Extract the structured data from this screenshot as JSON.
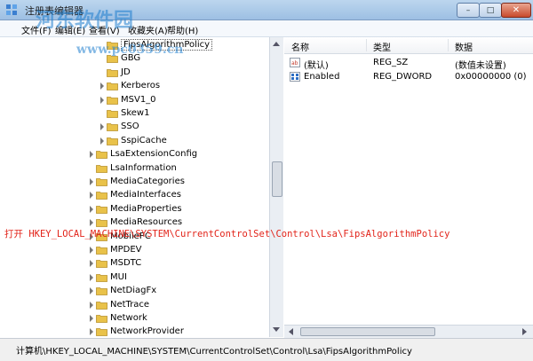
{
  "window": {
    "title": "注册表编辑器",
    "buttons": {
      "minimize": "–",
      "maximize": "□",
      "close": "✕"
    }
  },
  "menu": [
    "文件(F)",
    "编辑(E)",
    "查看(V)",
    "收藏夹(A)",
    "帮助(H)"
  ],
  "tree": {
    "items": [
      {
        "label": "FipsAlgorithmPolicy",
        "level": 2,
        "expander": false,
        "selected": true
      },
      {
        "label": "GBG",
        "level": 2,
        "expander": false,
        "selected": false
      },
      {
        "label": "JD",
        "level": 2,
        "expander": false,
        "selected": false
      },
      {
        "label": "Kerberos",
        "level": 2,
        "expander": true,
        "selected": false
      },
      {
        "label": "MSV1_0",
        "level": 2,
        "expander": true,
        "selected": false
      },
      {
        "label": "Skew1",
        "level": 2,
        "expander": false,
        "selected": false
      },
      {
        "label": "SSO",
        "level": 2,
        "expander": true,
        "selected": false
      },
      {
        "label": "SspiCache",
        "level": 2,
        "expander": true,
        "selected": false
      },
      {
        "label": "LsaExtensionConfig",
        "level": 1,
        "expander": true,
        "selected": false
      },
      {
        "label": "LsaInformation",
        "level": 1,
        "expander": false,
        "selected": false
      },
      {
        "label": "MediaCategories",
        "level": 1,
        "expander": true,
        "selected": false
      },
      {
        "label": "MediaInterfaces",
        "level": 1,
        "expander": true,
        "selected": false
      },
      {
        "label": "MediaProperties",
        "level": 1,
        "expander": true,
        "selected": false
      },
      {
        "label": "MediaResources",
        "level": 1,
        "expander": true,
        "selected": false
      },
      {
        "label": "MobilePC",
        "level": 1,
        "expander": true,
        "selected": false
      },
      {
        "label": "MPDEV",
        "level": 1,
        "expander": true,
        "selected": false
      },
      {
        "label": "MSDTC",
        "level": 1,
        "expander": true,
        "selected": false
      },
      {
        "label": "MUI",
        "level": 1,
        "expander": true,
        "selected": false
      },
      {
        "label": "NetDiagFx",
        "level": 1,
        "expander": true,
        "selected": false
      },
      {
        "label": "NetTrace",
        "level": 1,
        "expander": true,
        "selected": false
      },
      {
        "label": "Network",
        "level": 1,
        "expander": true,
        "selected": false
      },
      {
        "label": "NetworkProvider",
        "level": 1,
        "expander": true,
        "selected": false
      }
    ]
  },
  "list": {
    "columns": [
      "名称",
      "类型",
      "数据"
    ],
    "rows": [
      {
        "icon": "string-value-icon",
        "name": "(默认)",
        "type": "REG_SZ",
        "data": "(数值未设置)"
      },
      {
        "icon": "dword-value-icon",
        "name": "Enabled",
        "type": "REG_DWORD",
        "data": "0x00000000 (0)"
      }
    ]
  },
  "status": "计算机\\HKEY_LOCAL_MACHINE\\SYSTEM\\CurrentControlSet\\Control\\Lsa\\FipsAlgorithmPolicy",
  "annotation": "打开 HKEY_LOCAL_MACHINE\\SYSTEM\\CurrentControlSet\\Control\\Lsa\\FipsAlgorithmPolicy",
  "watermark": {
    "site_name": "河东软件园",
    "url": "www.pc0359.cn"
  },
  "colors": {
    "folder": "#e9c24a",
    "annotation": "#e2241a",
    "watermark": "#1f7fcf"
  }
}
